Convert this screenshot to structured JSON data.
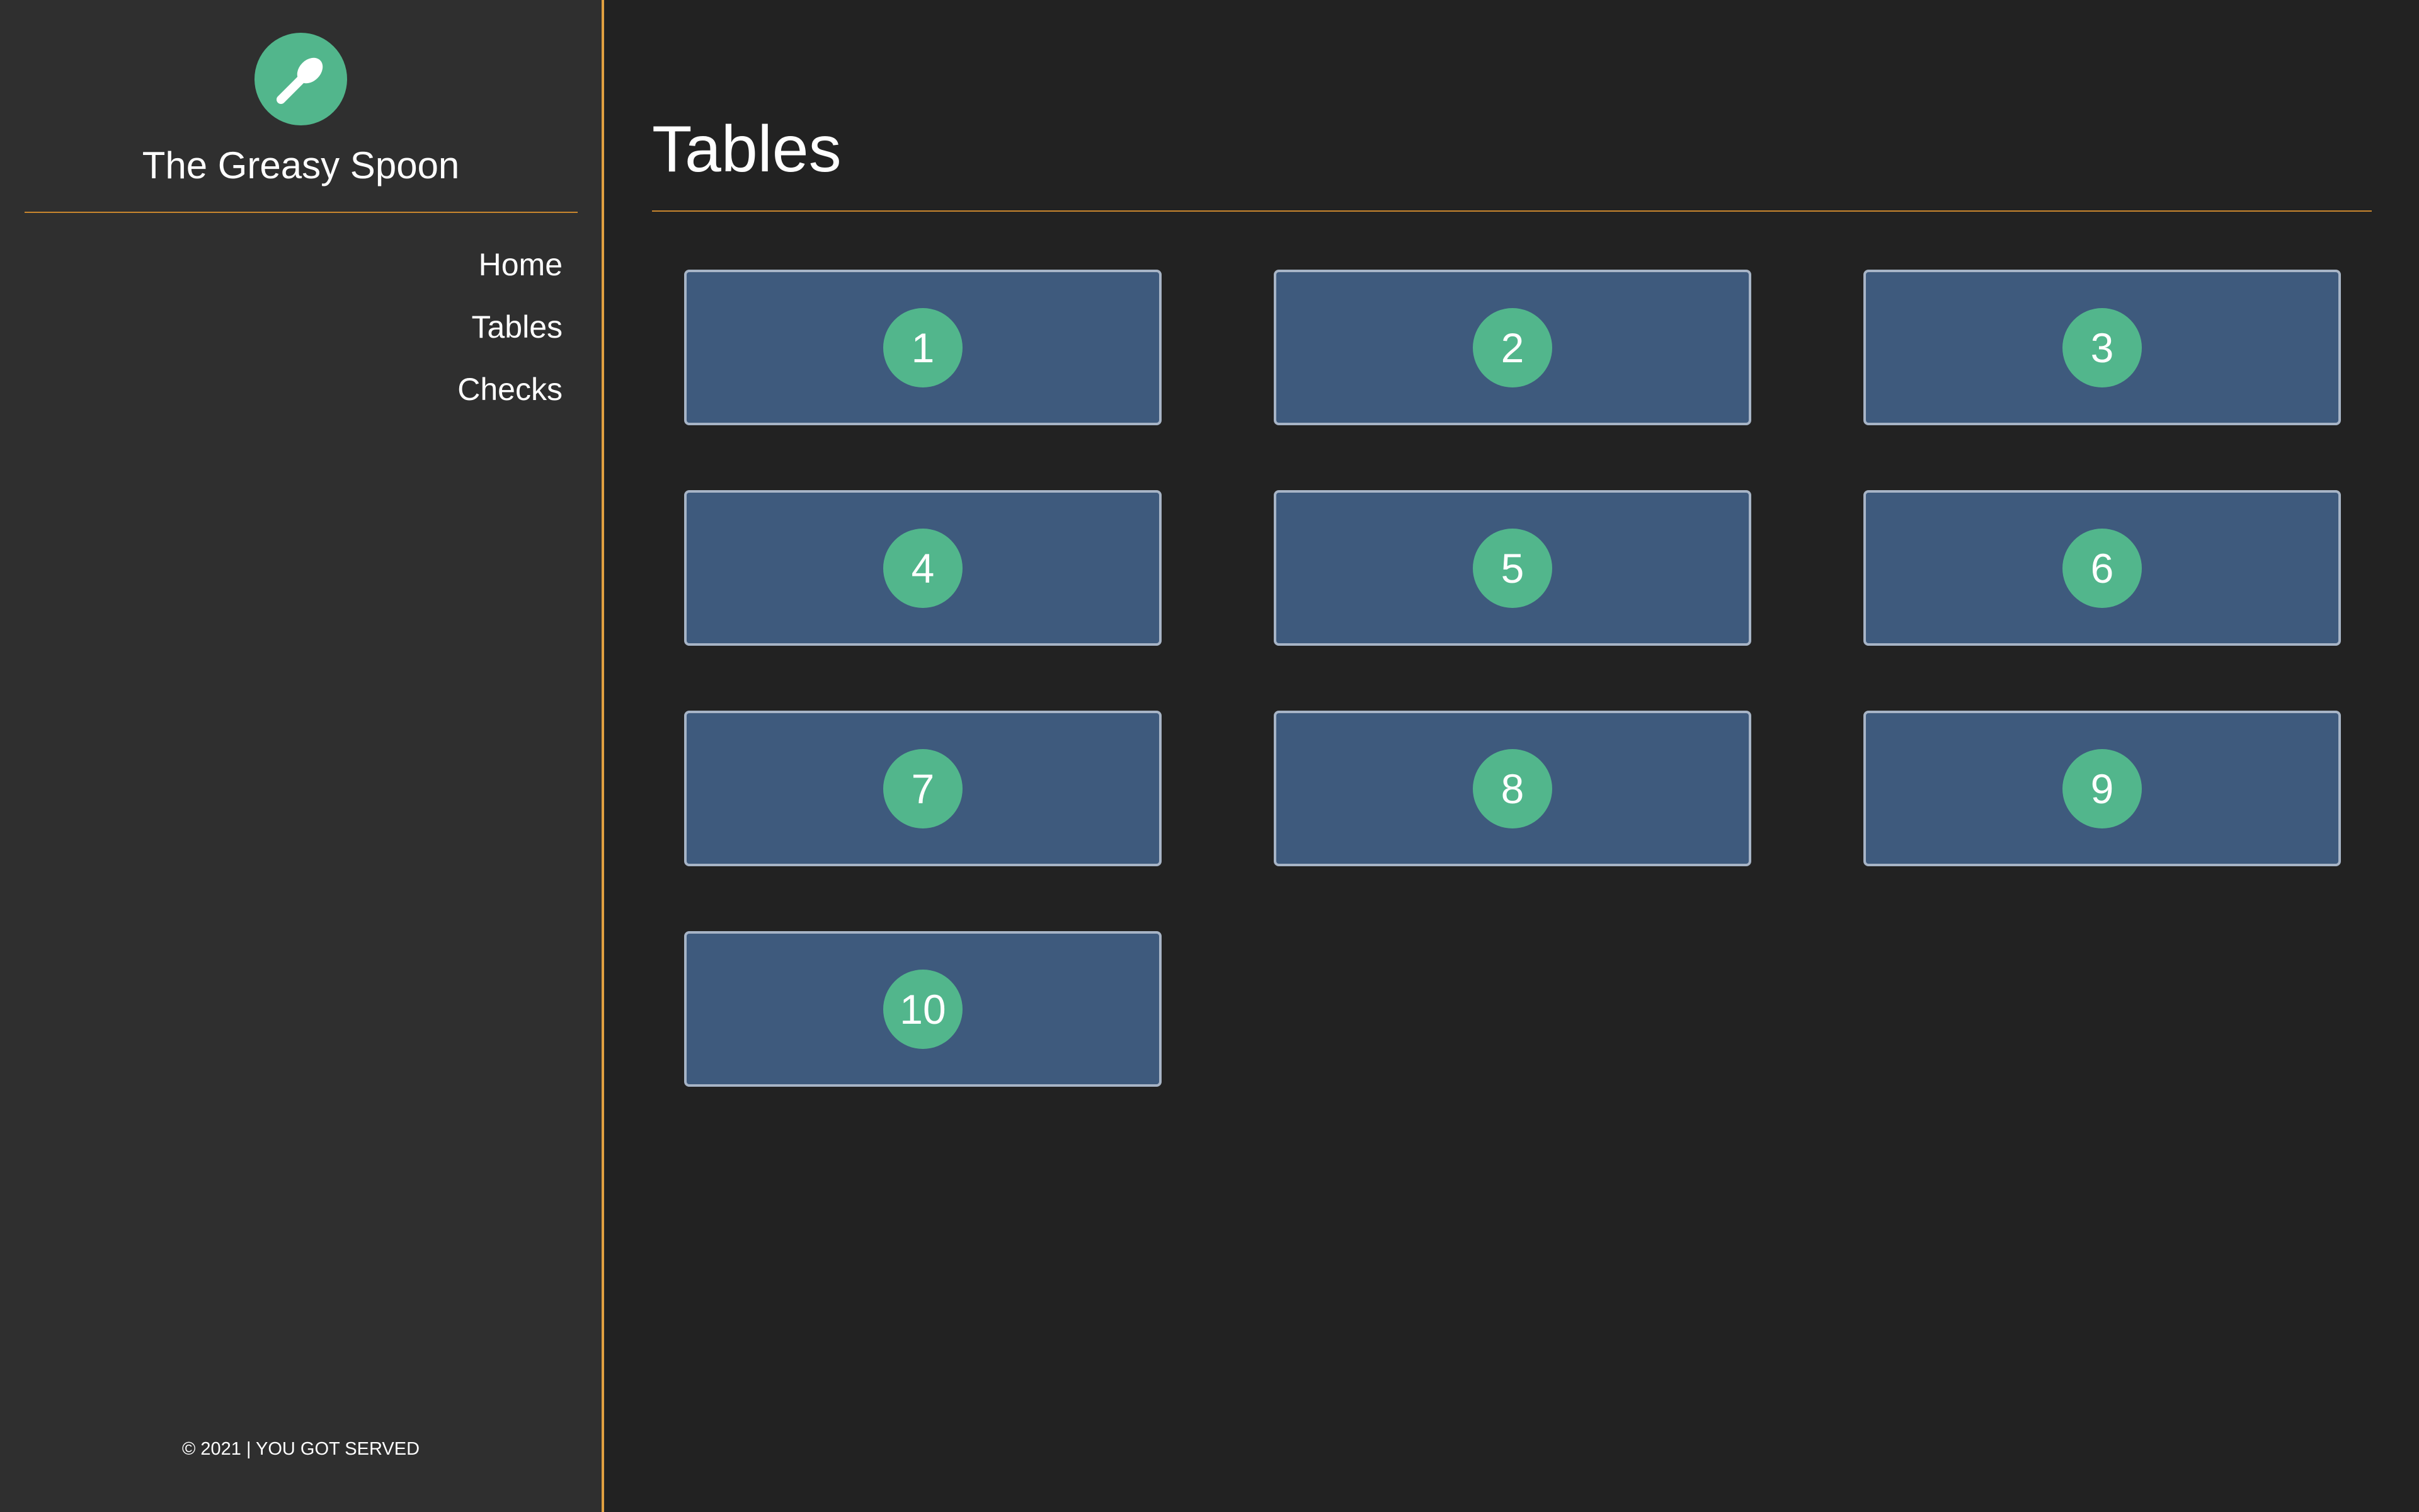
{
  "sidebar": {
    "logo_icon": "spoon-icon",
    "brand": "The Greasy Spoon",
    "nav": [
      {
        "label": "Home"
      },
      {
        "label": "Tables"
      },
      {
        "label": "Checks"
      }
    ],
    "footer": "© 2021 | YOU GOT SERVED"
  },
  "main": {
    "title": "Tables",
    "tables": [
      {
        "number": "1"
      },
      {
        "number": "2"
      },
      {
        "number": "3"
      },
      {
        "number": "4"
      },
      {
        "number": "5"
      },
      {
        "number": "6"
      },
      {
        "number": "7"
      },
      {
        "number": "8"
      },
      {
        "number": "9"
      },
      {
        "number": "10"
      }
    ]
  },
  "colors": {
    "background": "#222222",
    "sidebar": "#2f2f2f",
    "accent": "#e0a040",
    "brand_green": "#52b68c",
    "card": "#3e5a7d",
    "card_border": "#a7b4c6"
  }
}
